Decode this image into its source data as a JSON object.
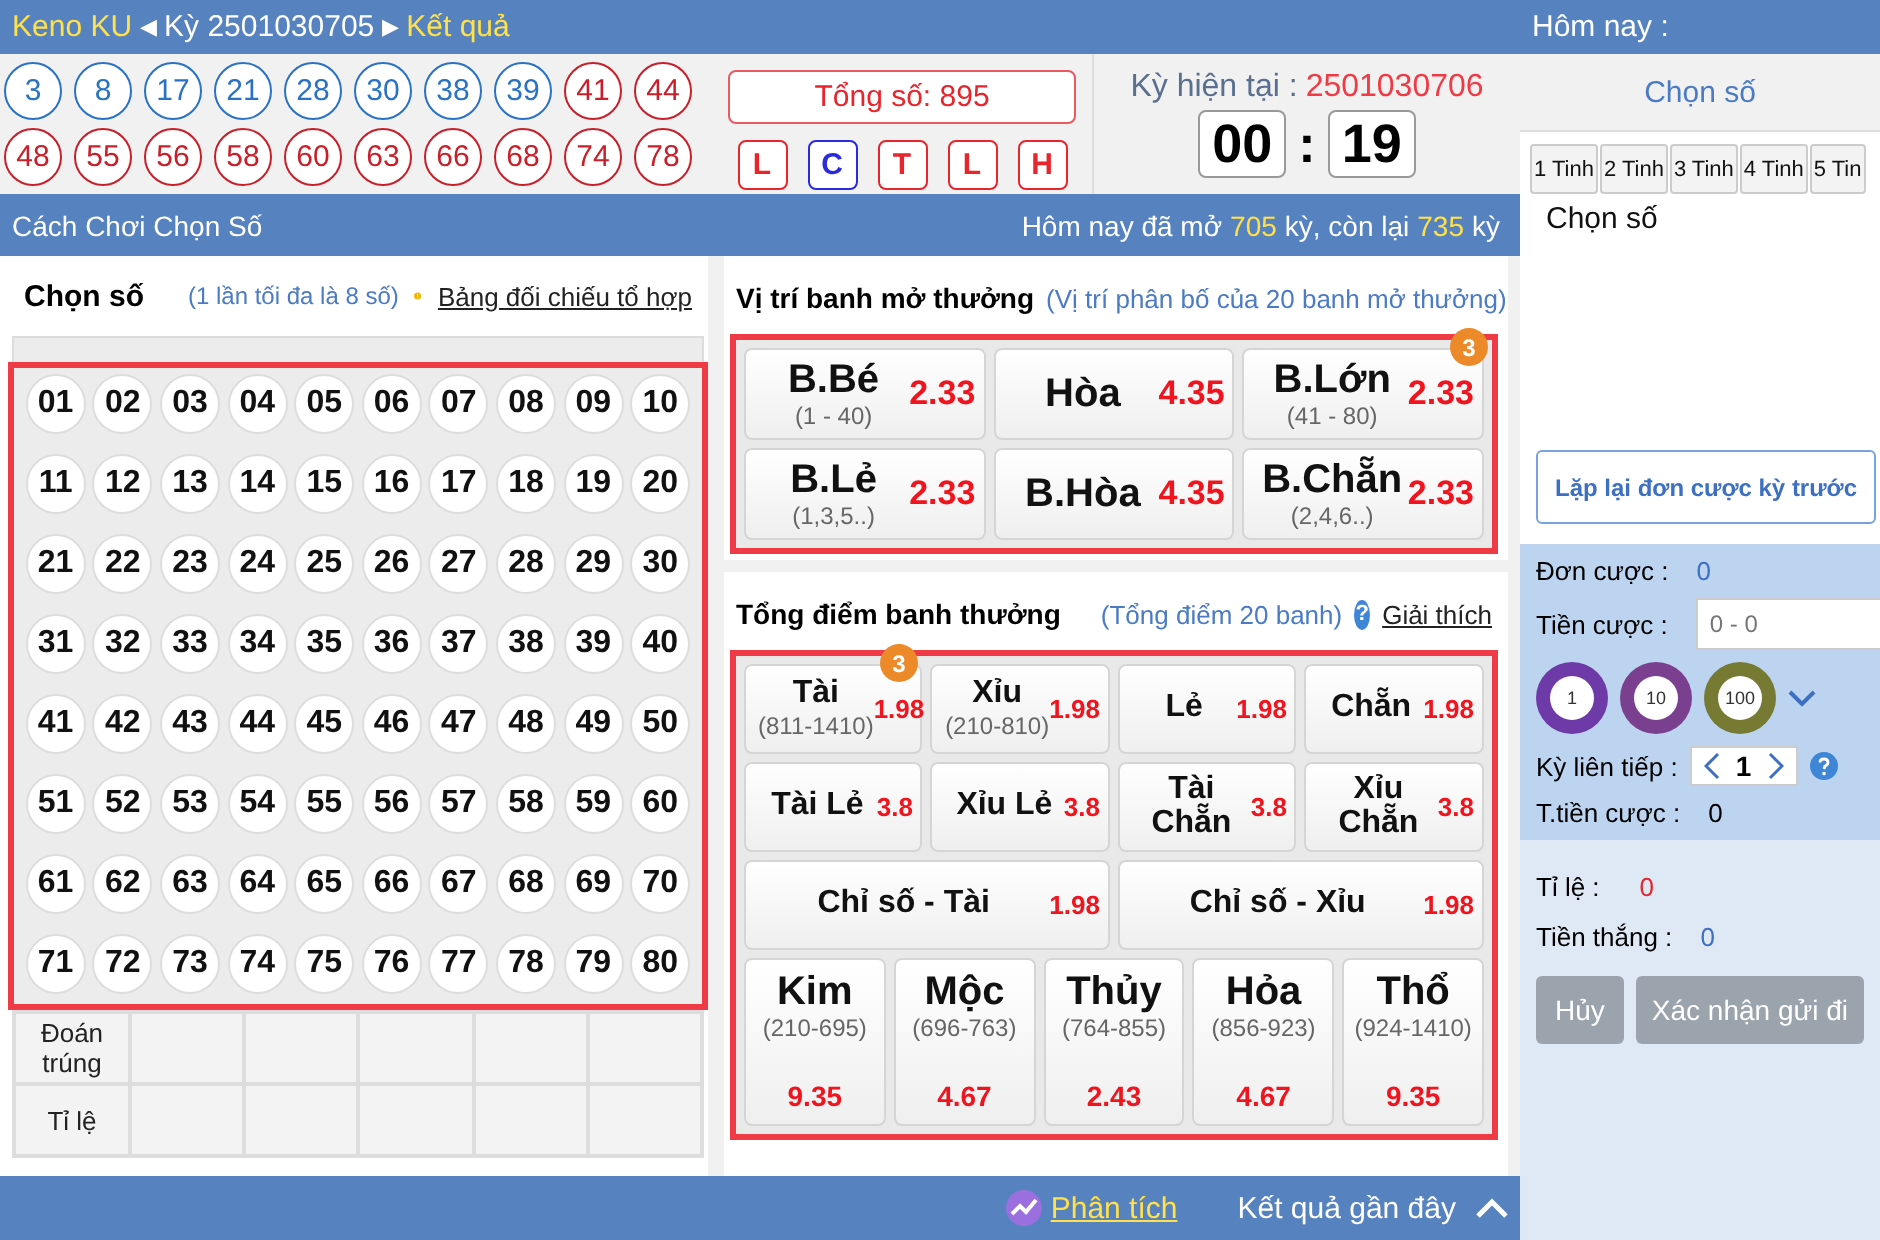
{
  "top_bar": {
    "game": "Keno KU",
    "prev": "◀",
    "draw": "Kỳ 2501030705",
    "next": "▶",
    "result_link": "Kết quả"
  },
  "results": [
    {
      "n": "3",
      "color": "#2a72c4"
    },
    {
      "n": "8",
      "color": "#2a72c4"
    },
    {
      "n": "17",
      "color": "#2a72c4"
    },
    {
      "n": "21",
      "color": "#2a72c4"
    },
    {
      "n": "28",
      "color": "#2a72c4"
    },
    {
      "n": "30",
      "color": "#2a72c4"
    },
    {
      "n": "38",
      "color": "#2a72c4"
    },
    {
      "n": "39",
      "color": "#2a72c4"
    },
    {
      "n": "41",
      "color": "#c8202a"
    },
    {
      "n": "44",
      "color": "#c8202a"
    },
    {
      "n": "48",
      "color": "#c8202a"
    },
    {
      "n": "55",
      "color": "#c8202a"
    },
    {
      "n": "56",
      "color": "#c8202a"
    },
    {
      "n": "58",
      "color": "#c8202a"
    },
    {
      "n": "60",
      "color": "#c8202a"
    },
    {
      "n": "63",
      "color": "#c8202a"
    },
    {
      "n": "66",
      "color": "#c8202a"
    },
    {
      "n": "68",
      "color": "#c8202a"
    },
    {
      "n": "74",
      "color": "#c8202a"
    },
    {
      "n": "78",
      "color": "#c8202a"
    }
  ],
  "total": "Tổng số: 895",
  "tags": [
    {
      "label": "L",
      "color": "#e8242c"
    },
    {
      "label": "C",
      "color": "#2a2ae0"
    },
    {
      "label": "T",
      "color": "#e8242c"
    },
    {
      "label": "L",
      "color": "#e8242c"
    },
    {
      "label": "H",
      "color": "#e8242c"
    }
  ],
  "current": {
    "label": "Kỳ hiện tại :",
    "draw": "2501030706",
    "minutes": "00",
    "sep": ":",
    "seconds": "19"
  },
  "header": {
    "title": "Cách Chơi Chọn Số",
    "opened_pre": "Hôm nay đã mở",
    "opened": "705",
    "mid": "kỳ, còn lại",
    "remaining": "735",
    "post": "kỳ"
  },
  "pick": {
    "title": "Chọn số",
    "hint": "(1 lần tối đa là 8 số)",
    "link": "Bảng đối chiếu tổ hợp",
    "numbers": [
      "01",
      "02",
      "03",
      "04",
      "05",
      "06",
      "07",
      "08",
      "09",
      "10",
      "11",
      "12",
      "13",
      "14",
      "15",
      "16",
      "17",
      "18",
      "19",
      "20",
      "21",
      "22",
      "23",
      "24",
      "25",
      "26",
      "27",
      "28",
      "29",
      "30",
      "31",
      "32",
      "33",
      "34",
      "35",
      "36",
      "37",
      "38",
      "39",
      "40",
      "41",
      "42",
      "43",
      "44",
      "45",
      "46",
      "47",
      "48",
      "49",
      "50",
      "51",
      "52",
      "53",
      "54",
      "55",
      "56",
      "57",
      "58",
      "59",
      "60",
      "61",
      "62",
      "63",
      "64",
      "65",
      "66",
      "67",
      "68",
      "69",
      "70",
      "71",
      "72",
      "73",
      "74",
      "75",
      "76",
      "77",
      "78",
      "79",
      "80"
    ],
    "table_rows": [
      "Đoán trúng",
      "Tỉ lệ"
    ]
  },
  "position": {
    "title": "Vị trí banh mở thưởng",
    "hint": "(Vị trí phân bố của 20 banh mở thưởng)",
    "items": [
      {
        "name": "B.Bé",
        "range": "(1 - 40)",
        "odds": "2.33"
      },
      {
        "name": "Hòa",
        "odds": "4.35"
      },
      {
        "name": "B.Lớn",
        "range": "(41 - 80)",
        "odds": "2.33",
        "badge": "3"
      },
      {
        "name": "B.Lẻ",
        "range": "(1,3,5..)",
        "odds": "2.33"
      },
      {
        "name": "B.Hòa",
        "odds": "4.35"
      },
      {
        "name": "B.Chẵn",
        "range": "(2,4,6..)",
        "odds": "2.33"
      }
    ]
  },
  "sum": {
    "title": "Tổng điểm banh thưởng",
    "hint": "(Tổng điểm 20 banh)",
    "help": "?",
    "link": "Giải thích",
    "items": [
      {
        "kind": "small",
        "name": "Tài",
        "range": "(811-1410)",
        "odds": "1.98",
        "badge": "3"
      },
      {
        "kind": "small",
        "name": "Xỉu",
        "range": "(210-810)",
        "odds": "1.98"
      },
      {
        "kind": "small",
        "name": "Lẻ",
        "odds": "1.98"
      },
      {
        "kind": "small",
        "name": "Chẵn",
        "odds": "1.98"
      },
      {
        "kind": "small",
        "name": "Tài Lẻ",
        "odds": "3.8"
      },
      {
        "kind": "small",
        "name": "Xỉu Lẻ",
        "odds": "3.8"
      },
      {
        "kind": "small",
        "name": "Tài Chẵn",
        "odds": "3.8"
      },
      {
        "kind": "small",
        "name": "Xỉu Chẵn",
        "odds": "3.8"
      },
      {
        "kind": "wide",
        "name": "Chỉ số - Tài",
        "odds": "1.98"
      },
      {
        "kind": "wide",
        "name": "Chỉ số - Xỉu",
        "odds": "1.98"
      },
      {
        "kind": "tall",
        "name": "Kim",
        "range": "(210-695)",
        "odds": "9.35"
      },
      {
        "kind": "tall",
        "name": "Mộc",
        "range": "(696-763)",
        "odds": "4.67"
      },
      {
        "kind": "tall",
        "name": "Thủy",
        "range": "(764-855)",
        "odds": "2.43"
      },
      {
        "kind": "tall",
        "name": "Hỏa",
        "range": "(856-923)",
        "odds": "4.67"
      },
      {
        "kind": "tall",
        "name": "Thổ",
        "range": "(924-1410)",
        "odds": "9.35"
      }
    ]
  },
  "footer": {
    "analysis": "Phân tích",
    "recent": "Kết quả gần đây"
  },
  "side": {
    "today": "Hôm nay :",
    "title": "Chọn số",
    "tabs": [
      {
        "label": "1 Tinh",
        "selected": false
      },
      {
        "label": "2 Tinh",
        "selected": false
      },
      {
        "label": "3 Tinh",
        "selected": false
      },
      {
        "label": "4 Tinh",
        "selected": false
      },
      {
        "label": "5 Tin",
        "selected": false
      }
    ],
    "picked_label": "Chọn số",
    "repeat": "Lặp lại đơn cược kỳ trước",
    "orders_label": "Đơn cược :",
    "orders": "0",
    "stake_label": "Tiền cược :",
    "stake_placeholder": "0 - 0",
    "chips": [
      "1",
      "10",
      "100"
    ],
    "consecutive_label": "Kỳ liên tiếp :",
    "consecutive": "1",
    "total_label": "T.tiền cược :",
    "total": "0",
    "rate_label": "Tỉ lệ :",
    "rate": "0",
    "win_label": "Tiền thắng :",
    "win": "0",
    "cancel": "Hủy",
    "confirm": "Xác nhận gửi đi"
  }
}
